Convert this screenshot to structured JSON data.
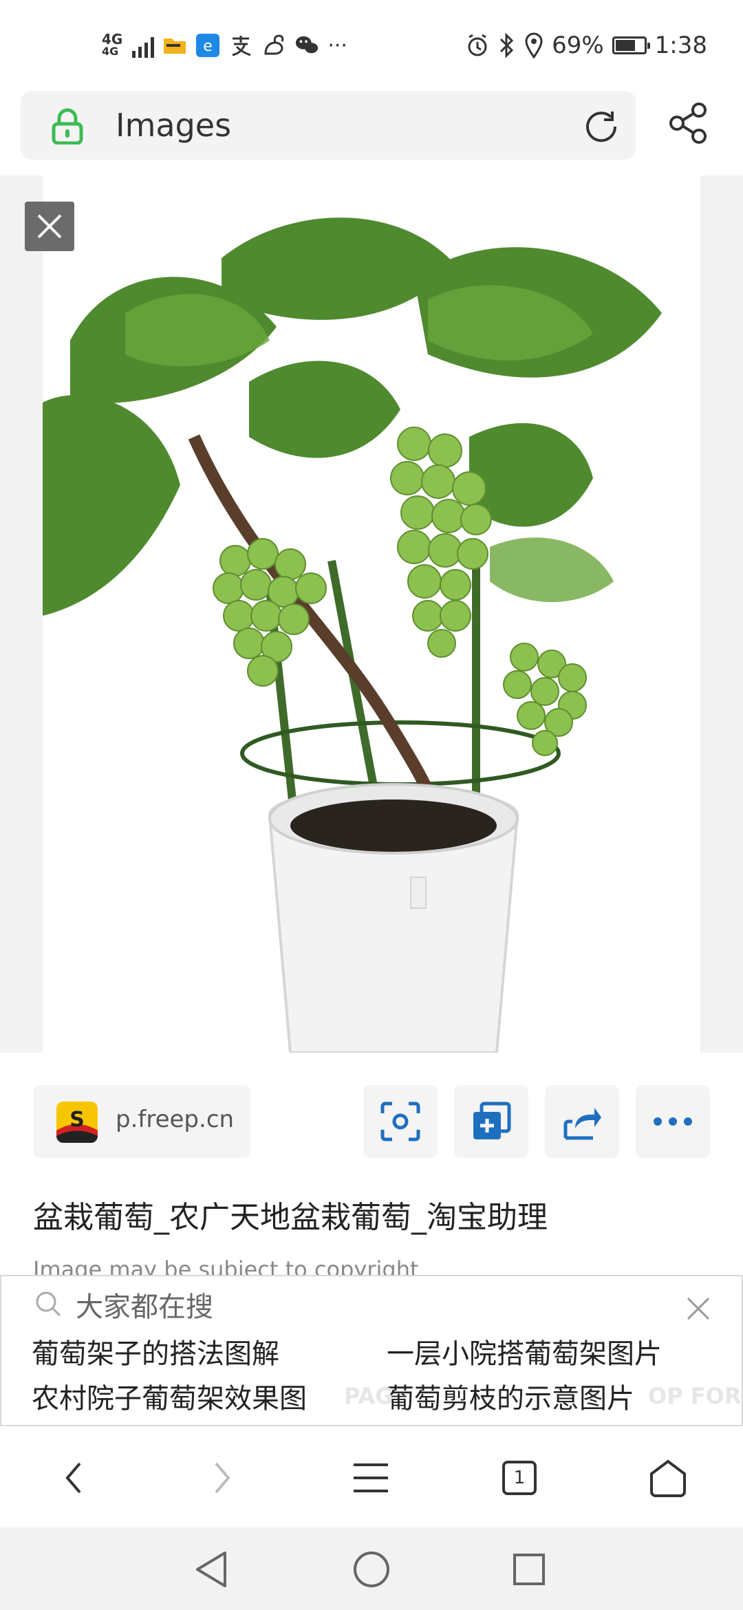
{
  "status_bar": {
    "network": "4G",
    "sub_network": "4G",
    "app_icons": [
      "file-manager-icon",
      "browser-e-icon",
      "alipay-icon",
      "squirrel-icon",
      "wechat-icon"
    ],
    "more": "···",
    "battery": "69%",
    "battery_level": 0.69,
    "time": "1:38"
  },
  "address_bar": {
    "title": "Images"
  },
  "image": {
    "subject": "potted-grape-plant"
  },
  "source": {
    "domain": "p.freep.cn",
    "logo_letter": "S"
  },
  "actions": [
    "visual-search-icon",
    "add-collection-icon",
    "share-icon",
    "more-icon"
  ],
  "title": "盆栽葡萄_农广天地盆栽葡萄_淘宝助理",
  "copyright": "Image may be subject to copyright",
  "suggestions": {
    "heading": "大家都在搜",
    "items": [
      "葡萄架子的搭法图解",
      "一层小院搭葡萄架图片",
      "农村院子葡萄架效果图",
      "葡萄剪枝的示意图片"
    ],
    "ghost_left": "PAG",
    "ghost_right": "OP FOR"
  },
  "toolbar": {
    "tab_count": "1"
  },
  "colors": {
    "lock_green": "#3cbb55",
    "action_blue": "#1f6fbf",
    "close_bg": "#6b6b6b"
  }
}
